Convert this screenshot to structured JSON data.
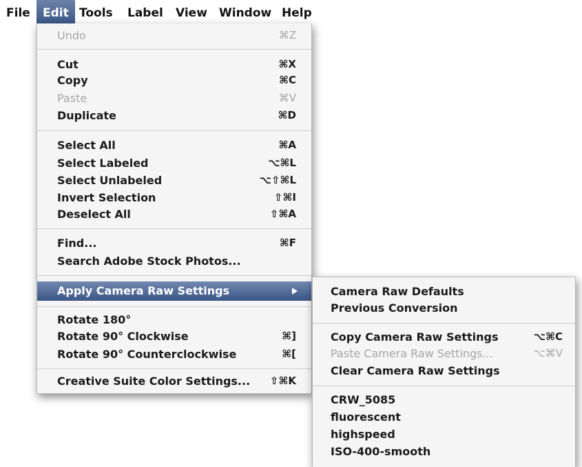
{
  "menubar": {
    "items": [
      "File",
      "Edit",
      "Tools",
      "Label",
      "View",
      "Window",
      "Help"
    ],
    "active": "Edit"
  },
  "edit_menu": {
    "undo": {
      "label": "Undo",
      "shortcut": "⌘Z"
    },
    "cut": {
      "label": "Cut",
      "shortcut": "⌘X"
    },
    "copy": {
      "label": "Copy",
      "shortcut": "⌘C"
    },
    "paste": {
      "label": "Paste",
      "shortcut": "⌘V"
    },
    "duplicate": {
      "label": "Duplicate",
      "shortcut": "⌘D"
    },
    "select_all": {
      "label": "Select All",
      "shortcut": "⌘A"
    },
    "select_labeled": {
      "label": "Select Labeled",
      "shortcut": "⌥⌘L"
    },
    "select_unlabeled": {
      "label": "Select Unlabeled",
      "shortcut": "⌥⇧⌘L"
    },
    "invert_selection": {
      "label": "Invert Selection",
      "shortcut": "⇧⌘I"
    },
    "deselect_all": {
      "label": "Deselect All",
      "shortcut": "⇧⌘A"
    },
    "find": {
      "label": "Find...",
      "shortcut": "⌘F"
    },
    "search_stock": {
      "label": "Search Adobe Stock Photos..."
    },
    "apply_camera_raw": {
      "label": "Apply Camera Raw Settings"
    },
    "rotate_180": {
      "label": "Rotate 180°"
    },
    "rotate_cw": {
      "label": "Rotate 90° Clockwise",
      "shortcut": "⌘]"
    },
    "rotate_ccw": {
      "label": "Rotate 90° Counterclockwise",
      "shortcut": "⌘["
    },
    "cs_color": {
      "label": "Creative Suite Color Settings...",
      "shortcut": "⇧⌘K"
    }
  },
  "submenu": {
    "defaults": {
      "label": "Camera Raw Defaults"
    },
    "previous": {
      "label": "Previous Conversion"
    },
    "copy_settings": {
      "label": "Copy Camera Raw Settings",
      "shortcut": "⌥⌘C"
    },
    "paste_settings": {
      "label": "Paste Camera Raw Settings...",
      "shortcut": "⌥⌘V"
    },
    "clear_settings": {
      "label": "Clear Camera Raw Settings"
    },
    "presets": [
      "CRW_5085",
      "fluorescent",
      "highspeed",
      "ISO-400-smooth"
    ]
  },
  "colors": {
    "highlight_top": "#7188b0",
    "highlight_bottom": "#3b5685",
    "menu_bg": "#f5f5f5",
    "disabled_text": "#a6a6a6"
  }
}
